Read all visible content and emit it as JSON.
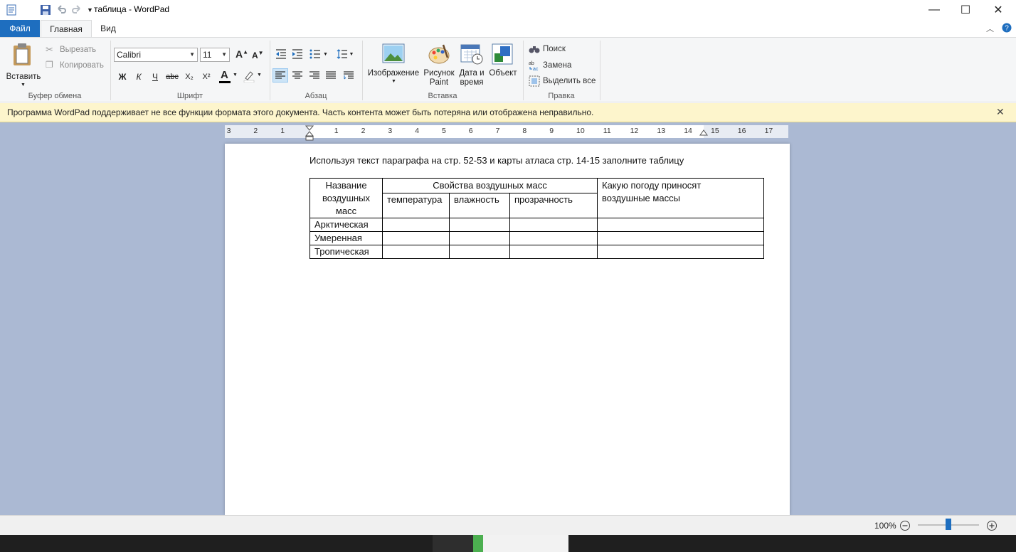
{
  "window": {
    "title": "таблица - WordPad",
    "minimize": "—",
    "maximize": "☐",
    "close": "✕"
  },
  "tabs": [
    {
      "label": "Файл"
    },
    {
      "label": "Главная"
    },
    {
      "label": "Вид"
    }
  ],
  "ribbon": {
    "clipboard": {
      "paste": "Вставить",
      "cut": "Вырезать",
      "copy": "Копировать",
      "label": "Буфер обмена"
    },
    "font": {
      "family": "Calibri",
      "size": "11",
      "grow": "A",
      "shrink": "A",
      "bold": "Ж",
      "italic": "К",
      "underline": "Ч",
      "strike": "abc",
      "sub": "X₂",
      "sup": "X²",
      "color": "A",
      "label": "Шрифт"
    },
    "paragraph": {
      "label": "Абзац"
    },
    "insert": {
      "image": "Изображение",
      "paint_line1": "Рисунок",
      "paint_line2": "Paint",
      "datetime_line1": "Дата и",
      "datetime_line2": "время",
      "object": "Объект",
      "label": "Вставка"
    },
    "editing": {
      "find": "Поиск",
      "replace": "Замена",
      "select_all": "Выделить все",
      "label": "Правка"
    }
  },
  "infobar": {
    "message": "Программа WordPad поддерживает не все функции формата этого документа. Часть контента может быть потеряна или отображена неправильно.",
    "close": "✕"
  },
  "ruler": {
    "numbers": [
      "3",
      "2",
      "1",
      "1",
      "2",
      "3",
      "4",
      "5",
      "6",
      "7",
      "8",
      "9",
      "10",
      "11",
      "12",
      "13",
      "14",
      "15",
      "16",
      "17"
    ]
  },
  "document": {
    "instruction": "Используя текст параграфа на стр. 52-53 и карты атласа стр. 14-15 заполните таблицу",
    "table": {
      "h_name_1": "Название",
      "h_name_2": "воздушных",
      "h_name_3": "масс",
      "h_props": "Свойства воздушных масс",
      "h_temp": "температура",
      "h_humid": "влажность",
      "h_transp": "прозрачность",
      "h_weather_1": "Какую погоду приносят",
      "h_weather_2": "воздушные массы",
      "rows": [
        {
          "name": "Арктическая"
        },
        {
          "name": "Умеренная"
        },
        {
          "name": "Тропическая"
        }
      ]
    }
  },
  "statusbar": {
    "zoom": "100%",
    "zoom_level": 0.5
  },
  "colors": {
    "file_tab": "#1e6ebf",
    "workspace": "#abb9d3",
    "infobar": "#fdf5cc"
  }
}
